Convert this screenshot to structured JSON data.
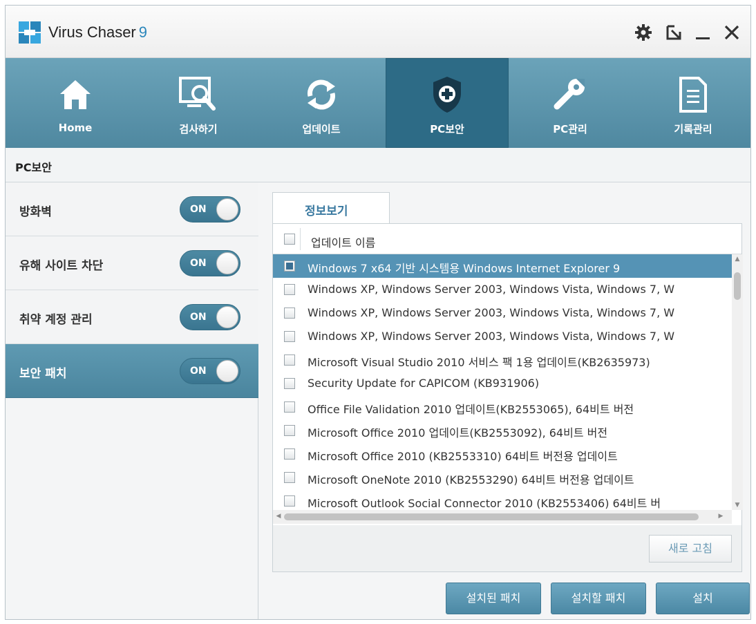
{
  "app": {
    "name": "Virus Chaser",
    "version": "9",
    "title_icons": [
      "settings-gear-icon",
      "minimize-to-tray-icon",
      "minimize-icon",
      "close-icon"
    ]
  },
  "nav": {
    "items": [
      {
        "label": "Home",
        "icon": "home-icon"
      },
      {
        "label": "검사하기",
        "icon": "scan-monitor-icon"
      },
      {
        "label": "업데이트",
        "icon": "refresh-icon"
      },
      {
        "label": "PC보안",
        "icon": "shield-icon",
        "active": true
      },
      {
        "label": "PC관리",
        "icon": "wrench-icon"
      },
      {
        "label": "기록관리",
        "icon": "document-icon"
      }
    ]
  },
  "section": {
    "title": "PC보안"
  },
  "sidebar": {
    "items": [
      {
        "label": "방화벽",
        "toggle": "ON"
      },
      {
        "label": "유해 사이트 차단",
        "toggle": "ON"
      },
      {
        "label": "취약 계정 관리",
        "toggle": "ON"
      },
      {
        "label": "보안 패치",
        "toggle": "ON",
        "active": true
      }
    ]
  },
  "panel": {
    "tab_label": "정보보기",
    "header_label": "업데이트 이름",
    "rows": [
      {
        "text": "Windows 7 x64 기반 시스템용 Windows Internet Explorer 9",
        "checked": true,
        "selected": true
      },
      {
        "text": "Windows XP, Windows Server 2003, Windows Vista, Windows 7, W",
        "checked": false
      },
      {
        "text": "Windows XP, Windows Server 2003, Windows Vista, Windows 7, W",
        "checked": false
      },
      {
        "text": "Windows XP, Windows Server 2003, Windows Vista, Windows 7, W",
        "checked": false
      },
      {
        "text": "Microsoft Visual Studio 2010 서비스 팩 1용 업데이트(KB2635973)",
        "checked": false
      },
      {
        "text": "Security Update for CAPICOM (KB931906)",
        "checked": false
      },
      {
        "text": "Office File Validation 2010 업데이트(KB2553065), 64비트 버전",
        "checked": false
      },
      {
        "text": "Microsoft Office 2010 업데이트(KB2553092), 64비트 버전",
        "checked": false
      },
      {
        "text": "Microsoft Office 2010 (KB2553310) 64비트 버전용 업데이트",
        "checked": false
      },
      {
        "text": "Microsoft OneNote 2010 (KB2553290) 64비트 버전용 업데이트",
        "checked": false
      },
      {
        "text": "Microsoft Outlook Social Connector 2010 (KB2553406) 64비트 버",
        "checked": false
      }
    ],
    "refresh_label": "새로 고침"
  },
  "buttons": {
    "installed": "설치된 패치",
    "to_install": "설치할 패치",
    "install": "설치"
  },
  "colors": {
    "nav_bg": "#5b93ab",
    "nav_active": "#2d6b86",
    "accent": "#2a86bb",
    "selected_row": "#5593b5"
  }
}
